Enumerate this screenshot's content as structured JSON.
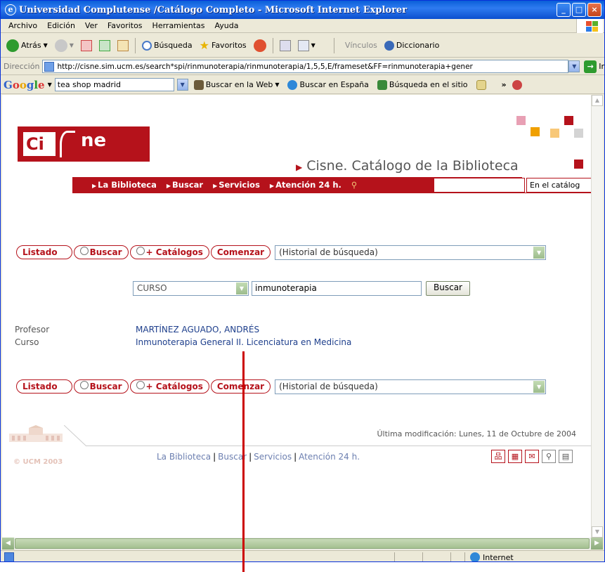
{
  "window": {
    "title": "Universidad Complutense /Catálogo Completo - Microsoft Internet Explorer",
    "controls": [
      "minimize",
      "maximize",
      "close"
    ]
  },
  "menubar": {
    "items": [
      "Archivo",
      "Edición",
      "Ver",
      "Favoritos",
      "Herramientas",
      "Ayuda"
    ]
  },
  "toolbar": {
    "back_label": "Atrás",
    "search_label": "Búsqueda",
    "favorites_label": "Favoritos",
    "links_label": "Vínculos",
    "dictionary_label": "Diccionario"
  },
  "address": {
    "label": "Dirección",
    "url": "http://cisne.sim.ucm.es/search*spi/rinmunoterapia/rinmunoterapia/1,5,5,E/frameset&FF=rinmunoterapia+gener",
    "go_label": "Ir"
  },
  "google": {
    "logo": "Google",
    "query": "tea shop madrid",
    "web_search": "Buscar en la Web",
    "spain_search": "Buscar en España",
    "site_search": "Búsqueda en el sitio",
    "more": "»"
  },
  "page": {
    "logo_left": "Ci",
    "logo_right": "ne",
    "catalog_title": "Cisne. Catálogo de la Biblioteca",
    "nav": [
      "La Biblioteca",
      "Buscar",
      "Servicios",
      "Atención 24 h."
    ],
    "nav_scope": "En el catálog",
    "buttons": {
      "listado": "Listado",
      "buscar": "Buscar",
      "catalogos": "+ Catálogos",
      "comenzar": "Comenzar"
    },
    "history_select": "(Historial de búsqueda)",
    "search": {
      "type": "CURSO",
      "query": "inmunoterapia",
      "button": "Buscar"
    },
    "record": [
      {
        "key": "Profesor",
        "value": "MARTÍNEZ AGUADO, ANDRÉS"
      },
      {
        "key": "Curso",
        "value": "Inmunoterapia General II. Licenciatura en Medicina"
      }
    ],
    "last_modified": "Última modificación: Lunes, 11 de Octubre de 2004",
    "copyright": "© UCM 2003",
    "footer_links": [
      "La Biblioteca",
      "Buscar",
      "Servicios",
      "Atención 24 h."
    ]
  },
  "status": {
    "zone": "Internet"
  },
  "colors": {
    "brand_red": "#b5121b",
    "link_blue": "#1e3f8c",
    "annotation_line": "#cc0000"
  }
}
